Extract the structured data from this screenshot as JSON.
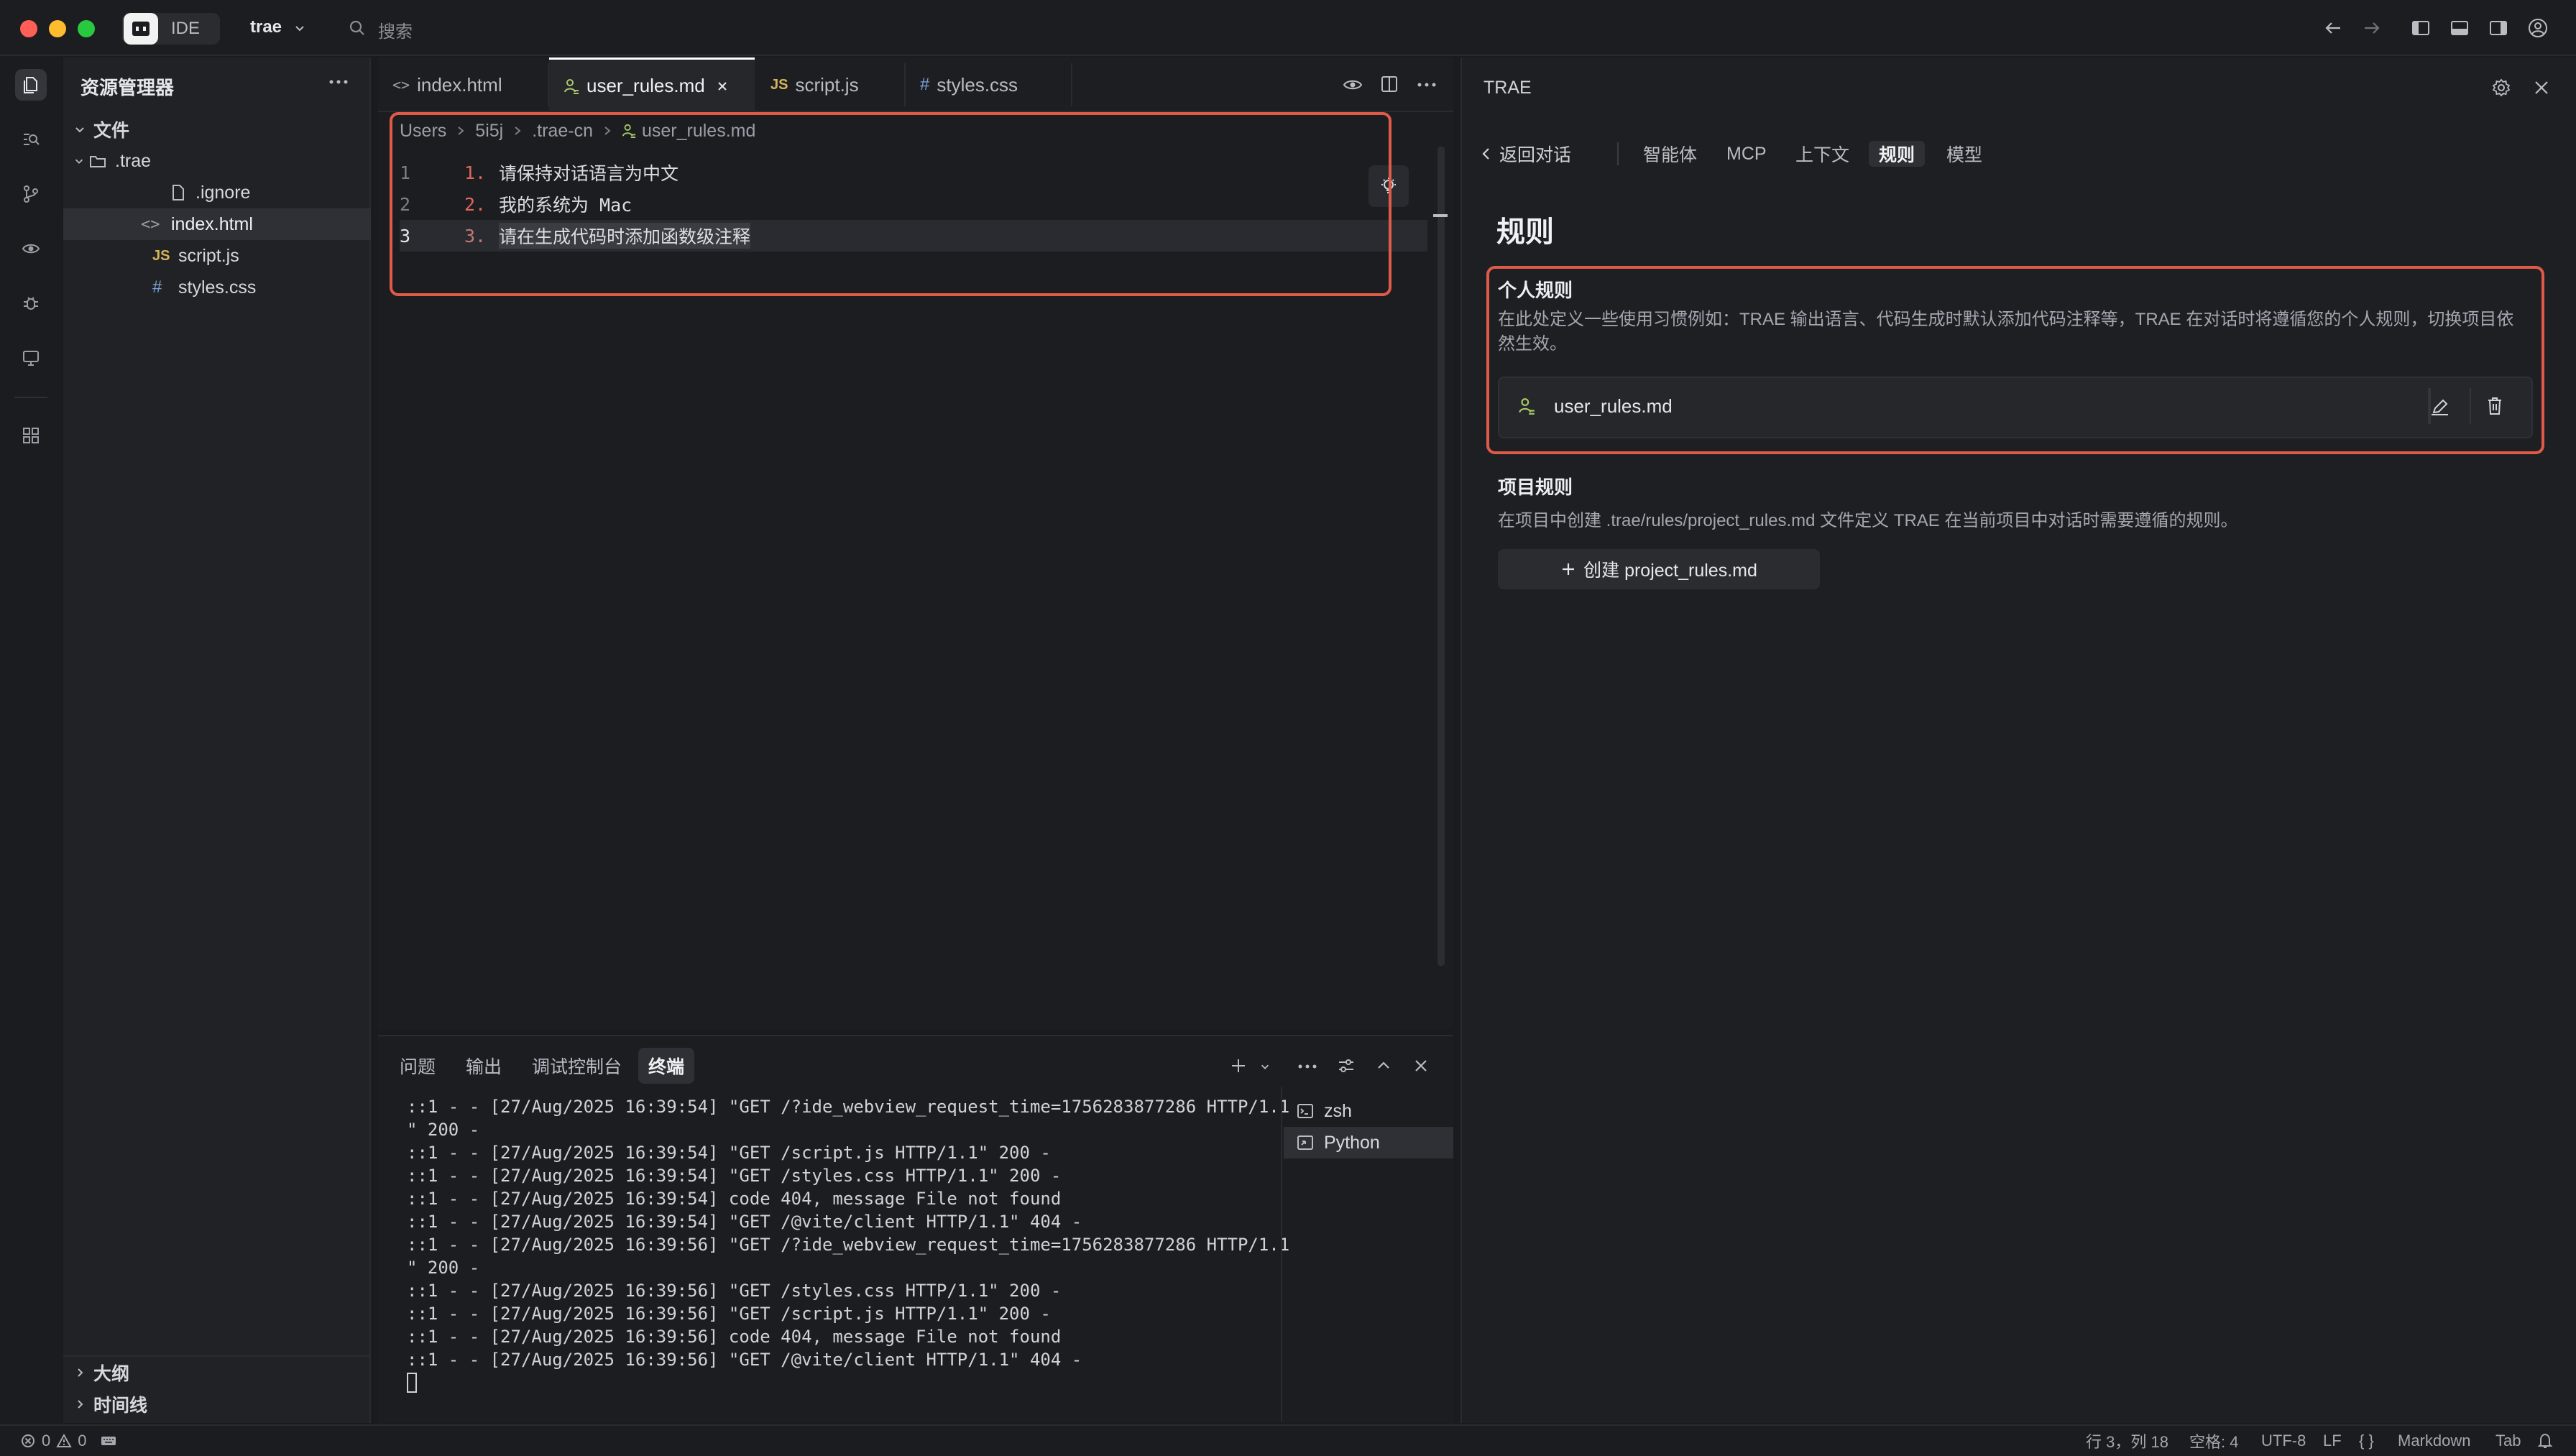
{
  "titlebar": {
    "app_label": "IDE",
    "project": "trae",
    "search_placeholder": "搜索"
  },
  "explorer": {
    "title": "资源管理器",
    "root": "文件",
    "items": [
      {
        "label": ".trae",
        "icon": "folder-icon"
      },
      {
        "label": ".ignore",
        "icon": "file-icon"
      },
      {
        "label": "index.html",
        "icon": "html-icon"
      },
      {
        "label": "script.js",
        "icon": "js-icon"
      },
      {
        "label": "styles.css",
        "icon": "css-icon"
      }
    ],
    "outline": "大纲",
    "timeline": "时间线"
  },
  "editor": {
    "tabs": [
      {
        "label": "index.html",
        "icon": "html-icon"
      },
      {
        "label": "user_rules.md",
        "icon": "user-rules-icon"
      },
      {
        "label": "script.js",
        "icon": "js-icon"
      },
      {
        "label": "styles.css",
        "icon": "css-icon"
      }
    ],
    "breadcrumb": [
      "Users",
      "5i5j",
      ".trae-cn",
      "user_rules.md"
    ],
    "lines": [
      {
        "no": "1",
        "marker": "1.",
        "text": "请保持对话语言为中文"
      },
      {
        "no": "2",
        "marker": "2.",
        "text": "我的系统为 Mac"
      },
      {
        "no": "3",
        "marker": "3.",
        "text": "请在生成代码时添加函数级注释"
      }
    ]
  },
  "panel": {
    "tabs": [
      "问题",
      "输出",
      "调试控制台",
      "终端"
    ],
    "terminal_lines": [
      "::1 - - [27/Aug/2025 16:39:54] \"GET /?ide_webview_request_time=1756283877286 HTTP/1.1",
      "\" 200 -",
      "::1 - - [27/Aug/2025 16:39:54] \"GET /script.js HTTP/1.1\" 200 -",
      "::1 - - [27/Aug/2025 16:39:54] \"GET /styles.css HTTP/1.1\" 200 -",
      "::1 - - [27/Aug/2025 16:39:54] code 404, message File not found",
      "::1 - - [27/Aug/2025 16:39:54] \"GET /@vite/client HTTP/1.1\" 404 -",
      "::1 - - [27/Aug/2025 16:39:56] \"GET /?ide_webview_request_time=1756283877286 HTTP/1.1",
      "\" 200 -",
      "::1 - - [27/Aug/2025 16:39:56] \"GET /styles.css HTTP/1.1\" 200 -",
      "::1 - - [27/Aug/2025 16:39:56] \"GET /script.js HTTP/1.1\" 200 -",
      "::1 - - [27/Aug/2025 16:39:56] code 404, message File not found",
      "::1 - - [27/Aug/2025 16:39:56] \"GET /@vite/client HTTP/1.1\" 404 -"
    ],
    "terminals": [
      "zsh",
      "Python"
    ]
  },
  "rightpanel": {
    "title": "TRAE",
    "back_label": "返回对话",
    "nav": [
      "智能体",
      "MCP",
      "上下文",
      "规则",
      "模型"
    ],
    "heading": "规则",
    "personal": {
      "title": "个人规则",
      "desc": "在此处定义一些使用习惯例如：TRAE 输出语言、代码生成时默认添加代码注释等，TRAE 在对话时将遵循您的个人规则，切换项目依然生效。",
      "file": "user_rules.md"
    },
    "project": {
      "title": "项目规则",
      "desc": "在项目中创建 .trae/rules/project_rules.md 文件定义 TRAE 在当前项目中对话时需要遵循的规则。",
      "create_label": "创建 project_rules.md"
    }
  },
  "statusbar": {
    "errors": "0",
    "warnings": "0",
    "position": "行 3，列 18",
    "spaces": "空格: 4",
    "encoding": "UTF-8",
    "eol": "LF",
    "braces": "{ }",
    "language": "Markdown",
    "tab": "Tab"
  },
  "colors": {
    "accent_red": "#e05a48",
    "background": "#1a1b1e"
  }
}
